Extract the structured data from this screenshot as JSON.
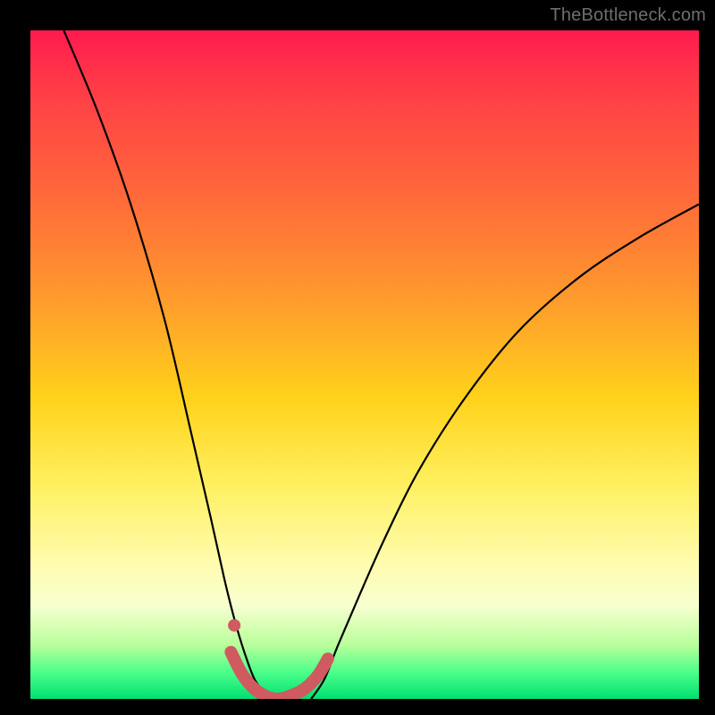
{
  "watermark": "TheBottleneck.com",
  "chart_data": {
    "type": "line",
    "title": "",
    "xlabel": "",
    "ylabel": "",
    "xlim": [
      0,
      100
    ],
    "ylim": [
      0,
      100
    ],
    "gradient_stops": [
      {
        "pos": 0,
        "color": "#ff1a4f"
      },
      {
        "pos": 25,
        "color": "#ff6a3a"
      },
      {
        "pos": 55,
        "color": "#ffd21a"
      },
      {
        "pos": 80,
        "color": "#fffcb0"
      },
      {
        "pos": 96,
        "color": "#4cff8a"
      },
      {
        "pos": 100,
        "color": "#00e072"
      }
    ],
    "series": [
      {
        "name": "left-curve",
        "x": [
          5,
          10,
          15,
          20,
          24,
          27,
          29,
          30.5,
          32,
          33.5,
          35,
          36
        ],
        "y": [
          100,
          88,
          74,
          57,
          40,
          27,
          18,
          12,
          7,
          3,
          1,
          0
        ]
      },
      {
        "name": "right-curve",
        "x": [
          42,
          44,
          46,
          49,
          53,
          58,
          65,
          73,
          82,
          91,
          100
        ],
        "y": [
          0,
          3,
          8,
          15,
          24,
          34,
          45,
          55,
          63,
          69,
          74
        ]
      },
      {
        "name": "floor-highlight",
        "x": [
          30,
          31.5,
          33,
          35,
          37,
          39,
          41,
          43,
          44.5
        ],
        "y": [
          7,
          4,
          2,
          0.5,
          0,
          0.5,
          1.5,
          3.5,
          6
        ]
      },
      {
        "name": "floor-dot",
        "x": [
          30.5
        ],
        "y": [
          11
        ]
      }
    ],
    "highlight_color": "#cf5a5f",
    "curve_color": "#000000"
  }
}
